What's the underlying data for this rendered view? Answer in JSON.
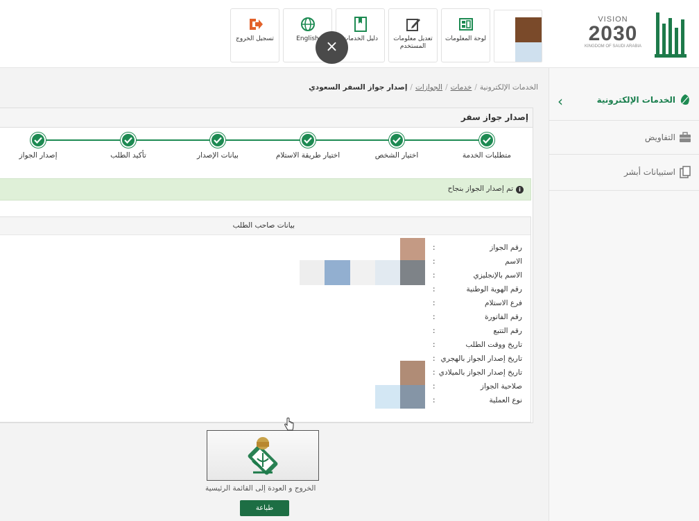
{
  "header": {
    "vision_label": "VISION",
    "vision_year": "2030",
    "vision_subtitle": "KINGDOM OF SAUDI ARABIA",
    "toolbar": [
      {
        "label": "لوحة المعلومات",
        "icon": "dashboard-icon"
      },
      {
        "label": "تعديل معلومات المستخدم",
        "icon": "edit-icon"
      },
      {
        "label": "دليل الخدمات",
        "icon": "book-icon"
      },
      {
        "label": "English",
        "icon": "globe-icon"
      },
      {
        "label": "تسجيل الخروج",
        "icon": "logout-icon"
      }
    ],
    "close_glyph": "×"
  },
  "sidebar": {
    "items": [
      {
        "label": "الخدمات الإلكترونية",
        "icon": "leaf-icon",
        "active": true
      },
      {
        "label": "التفاويض",
        "icon": "briefcase-icon"
      },
      {
        "label": "استبيانات أبشر",
        "icon": "survey-icon"
      }
    ],
    "chevron": "‹"
  },
  "breadcrumb": {
    "items": [
      "الخدمات الإلكترونية",
      "خدمات",
      "الجوازات",
      "إصدار جواز السفر السعودي"
    ],
    "separator": "/"
  },
  "card": {
    "title": "إصدار جواز سفر",
    "steps": [
      "متطلبات الخدمة",
      "اختيار الشخص",
      "اختيار طريقة الاستلام",
      "بيانات الإصدار",
      "تأكيد الطلب",
      "إصدار الجواز"
    ],
    "success_message": "تم إصدار الجواز بنجاح",
    "panel_title": "بيانات صاحب الطلب",
    "fields": [
      "رقم الجواز",
      "الاسم",
      "الاسم بالإنجليزي",
      "رقم الهوية الوطنية",
      "فرع الاستلام",
      "رقم الفاتورة",
      "رقم التتبع",
      "تاريخ ووقت الطلب",
      "تاريخ إصدار الجواز بالهجري",
      "تاريخ إصدار الجواز بالميلادي",
      "صلاحية الجواز",
      "نوع العملية"
    ],
    "colon": ":"
  },
  "footer": {
    "exit_link": "الخروج و العودة إلى القائمة الرئيسية",
    "print_label": "طباعة"
  },
  "colors": {
    "brand_green": "#1d8a52",
    "alert_bg": "#dff0d8",
    "button_green": "#1d6e44"
  }
}
